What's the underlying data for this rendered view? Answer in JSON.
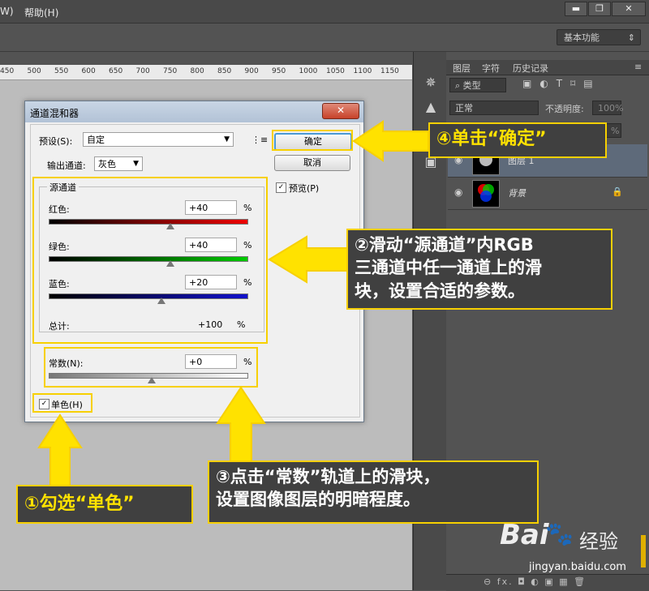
{
  "menu": {
    "item_w": "W)",
    "help": "帮助(H)"
  },
  "window_buttons": {
    "minimize": "▬",
    "restore": "❐",
    "close": "✕"
  },
  "workspace": {
    "label": "基本功能"
  },
  "ruler_ticks": [
    "450",
    "500",
    "550",
    "600",
    "650",
    "700",
    "750",
    "800",
    "850",
    "900",
    "950",
    "1000",
    "1050",
    "1100",
    "1150"
  ],
  "layers_panel": {
    "tabs": [
      "图层",
      "字符",
      "历史记录"
    ],
    "filter_label": "类型",
    "blend_mode": "正常",
    "opacity_label": "不透明度:",
    "opacity_value": "100%",
    "fill_value": "%",
    "layers": [
      {
        "name": "图层 1"
      },
      {
        "name": "背景"
      }
    ],
    "bottom_icons": "⊖  fx.  ◘  ◐  ▣  ▦  🗑"
  },
  "dialog": {
    "title": "通道混和器",
    "close": "✕",
    "preset_label": "预设(S):",
    "preset_value": "自定",
    "output_label": "输出通道:",
    "output_value": "灰色",
    "ok_button": "确定",
    "cancel_button": "取消",
    "preview_label": "预览(P)",
    "source_group": "源通道",
    "red_label": "红色:",
    "red_value": "+40",
    "green_label": "绿色:",
    "green_value": "+40",
    "blue_label": "蓝色:",
    "blue_value": "+20",
    "total_label": "总计:",
    "total_value": "+100",
    "percent": "%",
    "constant_label": "常数(N):",
    "constant_value": "+0",
    "mono_label": "单色(H)",
    "check": "✓"
  },
  "callouts": {
    "c4": "④单击“确定”",
    "c2_line1": "②滑动“源通道”内RGB",
    "c2_line2": "三通道中任一通道上的滑",
    "c2_line3": "块，设置合适的参数。",
    "c3_line1": "③点击“常数”轨道上的滑块，",
    "c3_line2": "设置图像图层的明暗程度。",
    "c1": "①勾选“单色”"
  },
  "watermark": {
    "brand": "Bai",
    "brand2": "经验",
    "url": "jingyan.baidu.com"
  },
  "colors": {
    "highlight": "#f7d000",
    "callout_bg": "#404040"
  }
}
